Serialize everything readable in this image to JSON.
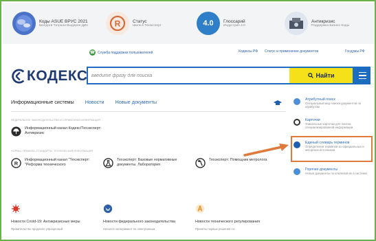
{
  "colors": {
    "accent": "#1c6cc0",
    "search_button": "#f5e11a",
    "highlight": "#e07a3c",
    "frame": "#6ab04c"
  },
  "promo": [
    {
      "title": "Коды АSUE ВРУС 2021",
      "sub": "Бюлдоги Татрали Выдерян ДИо",
      "icon": "globe-icon"
    },
    {
      "title": "Статус",
      "sub": "Шилк в Техэксперт",
      "icon": "status-r-icon"
    },
    {
      "title": "Глоссарий",
      "sub": "Индустрия 4.0",
      "icon": "glossary-4-0-icon",
      "badge": "4.0"
    },
    {
      "title": "Антикризис",
      "sub": "Поддержка Бизнес Коды",
      "icon": "anticrisis-icon"
    }
  ],
  "support": {
    "label": "Служба поддержки пользователей",
    "links": [
      "Кодексы РФ",
      "Статус и применение документов",
      "Госдумы РФ"
    ]
  },
  "header": {
    "logo_text": "КОДЕКС",
    "search_placeholder": "введите фразу для поиска",
    "search_button": "Найти"
  },
  "tabs": [
    "Информационные системы",
    "Новости",
    "Новые документы"
  ],
  "sections": {
    "legal": "ФЕДЕРАЛЬНОЕ ЗАКОНОДАТЕЛЬСТВО И СПРАВОЧНАЯ ИНФОРМАЦИЯ",
    "norms": "НОРМЫ, ПРАВИЛА, СТАНДАРТЫ, ТЕХНИЧЕСКАЯ ИНФОРМАЦИЯ"
  },
  "cards": [
    {
      "title": "Информационный канал Кодекс/Техэксперт: Антикризис",
      "icon": "umbrella-icon"
    },
    {
      "title": "Информационный канал \"Техэксперт: \"Реформа технического",
      "icon": "reform-r-icon"
    },
    {
      "title": "Техэксперт: Базовые нормативные документы. Лаборатория",
      "icon": "lab-flask-icon"
    },
    {
      "title": "Техэксперт: Помощник метролога",
      "icon": "metrology-icon"
    }
  ],
  "tiles": [
    {
      "title": "Новости Covid-19: Антикризисные меры",
      "sub": "Правительство продлило упрощенный",
      "icon": "virus-icon"
    },
    {
      "title": "Новости федерального законодательства",
      "sub": "Начался эксперимент по электронным",
      "icon": "eagle-emblem-icon"
    },
    {
      "title": "Новости технического регулирования",
      "sub": "Приняты первые решения по",
      "icon": "tech-regulation-icon"
    }
  ],
  "right_panel": [
    {
      "title": "Атрибутный поиск",
      "desc": "Специальный вид поиска документов по атрибутам",
      "icon": "attribute-search-icon",
      "color": "#4a8fd8"
    },
    {
      "title": "Карточки",
      "desc": "Уникальные карточки для поиска специализированной информации",
      "icon": "cards-icon",
      "color": "#333333"
    },
    {
      "title": "Единый словарь терминов",
      "desc": "Определения терминов из официальных и авторских источников",
      "icon": "dictionary-icon",
      "color": "#1f5fb0"
    },
    {
      "title": "Горячие документы",
      "desc": "Новые документы по ключевой их в системы",
      "icon": "hot-documents-icon",
      "color": "#4a8fd8"
    }
  ]
}
